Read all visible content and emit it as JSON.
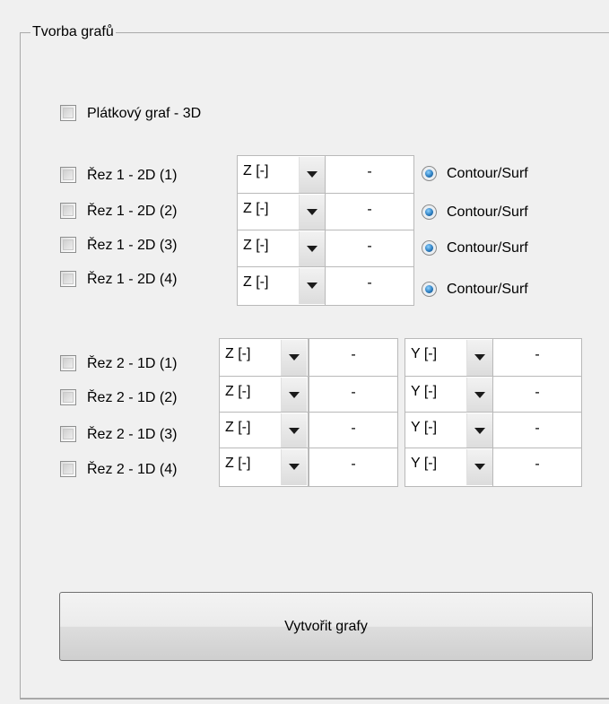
{
  "group": {
    "title": "Tvorba grafů"
  },
  "plate": {
    "label": "Plátkový graf - 3D"
  },
  "cuts2d": [
    {
      "label": "Řez 1 - 2D (1)",
      "axis": "Z [-]",
      "value": "-",
      "mode": "Contour/Surf"
    },
    {
      "label": "Řez 1 - 2D (2)",
      "axis": "Z [-]",
      "value": "-",
      "mode": "Contour/Surf"
    },
    {
      "label": "Řez 1 - 2D (3)",
      "axis": "Z [-]",
      "value": "-",
      "mode": "Contour/Surf"
    },
    {
      "label": "Řez 1 - 2D (4)",
      "axis": "Z [-]",
      "value": "-",
      "mode": "Contour/Surf"
    }
  ],
  "cuts1d": [
    {
      "label": "Řez 2 - 1D (1)",
      "axis1": "Z [-]",
      "value1": "-",
      "axis2": "Y [-]",
      "value2": "-"
    },
    {
      "label": "Řez 2 - 1D (2)",
      "axis1": "Z [-]",
      "value1": "-",
      "axis2": "Y [-]",
      "value2": "-"
    },
    {
      "label": "Řez 2 - 1D (3)",
      "axis1": "Z [-]",
      "value1": "-",
      "axis2": "Y [-]",
      "value2": "-"
    },
    {
      "label": "Řez 2 - 1D (4)",
      "axis1": "Z [-]",
      "value1": "-",
      "axis2": "Y [-]",
      "value2": "-"
    }
  ],
  "actions": {
    "create_label": "Vytvořit grafy"
  },
  "icons": {
    "dropdown": "chevron-down-icon",
    "radio": "radio-selected-icon"
  }
}
